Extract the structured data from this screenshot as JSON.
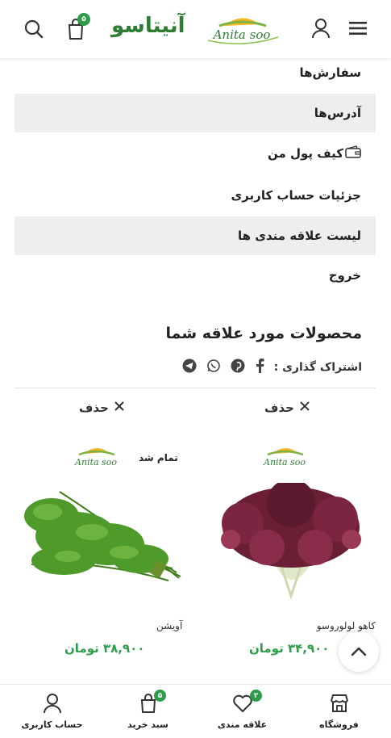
{
  "header": {
    "brand_name": "آنیتاسو",
    "cart_count": "۵",
    "icons": [
      "search-icon",
      "cart-icon",
      "user-icon",
      "hamburger-menu-icon"
    ]
  },
  "account_menu": [
    {
      "label": "سفارش‌ها",
      "highlighted": false
    },
    {
      "label": "آدرس‌ها",
      "highlighted": true
    },
    {
      "label": "کیف پول من",
      "highlighted": false,
      "icon": "wallet-icon"
    },
    {
      "label": "جزئیات حساب کاربری",
      "highlighted": false
    },
    {
      "label": "لیست علاقه مندی ها",
      "highlighted": true
    },
    {
      "label": "خروج",
      "highlighted": false
    }
  ],
  "wishlist": {
    "title": "محصولات مورد علاقه شما",
    "share_label": "اشتراک گذاری :",
    "share_icons": [
      "facebook-icon",
      "pinterest-icon",
      "whatsapp-icon",
      "telegram-icon"
    ],
    "products": [
      {
        "remove_label": "حذف",
        "name": "کاهو لولوروسو",
        "price": "۳۴,۹۰۰ تومان",
        "sold_out": ""
      },
      {
        "remove_label": "حذف",
        "name": "آویشن",
        "price": "۳۸,۹۰۰ تومان",
        "sold_out": "تمام شد"
      }
    ]
  },
  "bottom_nav": {
    "items": [
      {
        "label": "فروشگاه",
        "icon": "store-icon"
      },
      {
        "label": "علاقه مندی",
        "icon": "heart-icon",
        "badge": "۲"
      },
      {
        "label": "سبد خرید",
        "icon": "cart-icon",
        "badge": "۵"
      },
      {
        "label": "حساب کاربری",
        "icon": "user-icon"
      }
    ]
  },
  "colors": {
    "accent_green": "#2e9d4a",
    "highlight_bg": "#eeeeee"
  }
}
